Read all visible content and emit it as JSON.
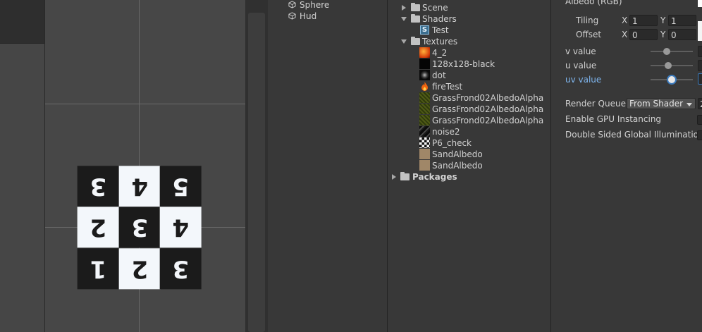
{
  "hierarchy": {
    "items": [
      {
        "label": "Sphere",
        "icon": "cube-icon"
      },
      {
        "label": "Hud",
        "icon": "cube-icon"
      }
    ]
  },
  "scene": {
    "checker_numbers": [
      "3",
      "2",
      "1",
      "4",
      "3",
      "2",
      "5",
      "4",
      "3"
    ],
    "colors": {
      "dark_cell": "#1b1b1b",
      "light_cell": "#f3f7fb"
    }
  },
  "project": {
    "items": [
      {
        "label": "Scene",
        "type": "folder",
        "expanded": false
      },
      {
        "label": "Shaders",
        "type": "folder",
        "expanded": true
      },
      {
        "label": "Test",
        "type": "shader"
      },
      {
        "label": "Textures",
        "type": "folder",
        "expanded": true
      },
      {
        "label": "4_2",
        "type": "texture",
        "thumb": "fire-orange"
      },
      {
        "label": "128x128-black",
        "type": "texture",
        "thumb": "black"
      },
      {
        "label": "dot",
        "type": "texture",
        "thumb": "dot"
      },
      {
        "label": "fireTest",
        "type": "texture",
        "thumb": "flame"
      },
      {
        "label": "GrassFrond02AlbedoAlpha",
        "type": "texture",
        "thumb": "grass"
      },
      {
        "label": "GrassFrond02AlbedoAlpha",
        "type": "texture",
        "thumb": "grass"
      },
      {
        "label": "GrassFrond02AlbedoAlpha",
        "type": "texture",
        "thumb": "grass"
      },
      {
        "label": "noise2",
        "type": "texture",
        "thumb": "noise"
      },
      {
        "label": "P6_check",
        "type": "texture",
        "thumb": "checker"
      },
      {
        "label": "SandAlbedo",
        "type": "texture",
        "thumb": "sand"
      },
      {
        "label": "SandAlbedo",
        "type": "texture",
        "thumb": "sand"
      },
      {
        "label": "Packages",
        "type": "folder",
        "expanded": false
      }
    ]
  },
  "inspector": {
    "albedo_label": "Albedo (RGB)",
    "tiling_label": "Tiling",
    "offset_label": "Offset",
    "x_label": "X",
    "y_label": "Y",
    "tiling_x": "1",
    "tiling_y": "1",
    "offset_x": "0",
    "offset_y": "0",
    "v_value_label": "v value",
    "u_value_label": "u value",
    "uv_value_label": "uv value",
    "render_queue_label": "Render Queue",
    "render_queue_value": "From Shader",
    "render_queue_number": "2",
    "gpu_instancing_label": "Enable GPU Instancing",
    "double_sided_label": "Double Sided Global Illumination",
    "accent_color": "#7fb6ef"
  }
}
